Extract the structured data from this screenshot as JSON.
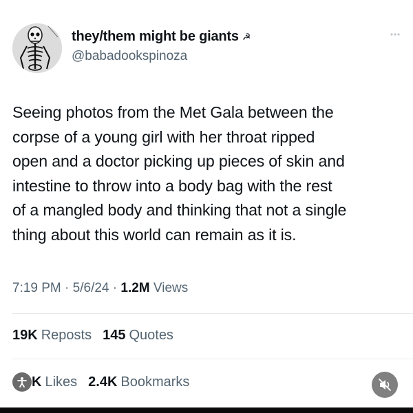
{
  "user": {
    "display_name": "they/them might be giants",
    "name_emoji": "☭",
    "handle": "@babadookspinoza"
  },
  "tweet": {
    "lines": [
      "Seeing photos from the Met Gala between the",
      "corpse of a young girl with her throat ripped",
      "open and a doctor picking up pieces of skin and",
      "intestine to throw into a body bag with the rest",
      "of a mangled body and thinking that not a single",
      "thing about this world can remain as it is."
    ]
  },
  "meta": {
    "time": "7:19 PM",
    "sep1": " · ",
    "date": "5/6/24",
    "sep2": " · ",
    "views_count": "1.2M",
    "views_label": " Views"
  },
  "stats": {
    "reposts_count": "19K",
    "reposts_label": "Reposts",
    "quotes_count": "145",
    "quotes_label": "Quotes",
    "likes_count": "K",
    "likes_label": "Likes",
    "bookmarks_count": "2.4K",
    "bookmarks_label": "Bookmarks"
  },
  "icons": {
    "more": "more-icon",
    "accessibility": "accessibility-icon",
    "mute": "speaker-muted-icon"
  }
}
